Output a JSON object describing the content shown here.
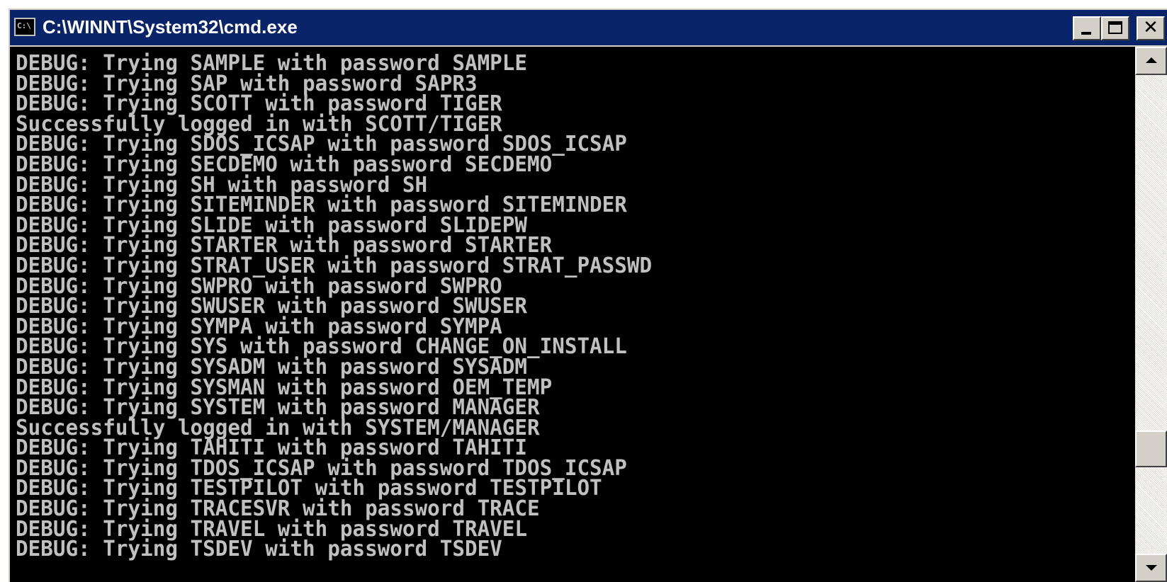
{
  "window": {
    "title": "C:\\WINNT\\System32\\cmd.exe",
    "icon": "cmd-prompt-icon",
    "icon_text": "C:\\",
    "buttons": {
      "minimize": "minimize-icon",
      "maximize": "maximize-icon",
      "close": "✕"
    }
  },
  "console": {
    "foreground": "#c0c0c0",
    "background": "#000000",
    "lines": [
      "DEBUG: Trying SAMPLE with password SAMPLE",
      "DEBUG: Trying SAP with password SAPR3",
      "DEBUG: Trying SCOTT with password TIGER",
      "Successfully logged in with SCOTT/TIGER",
      "DEBUG: Trying SDOS_ICSAP with password SDOS_ICSAP",
      "DEBUG: Trying SECDEMO with password SECDEMO",
      "DEBUG: Trying SH with password SH",
      "DEBUG: Trying SITEMINDER with password SITEMINDER",
      "DEBUG: Trying SLIDE with password SLIDEPW",
      "DEBUG: Trying STARTER with password STARTER",
      "DEBUG: Trying STRAT_USER with password STRAT_PASSWD",
      "DEBUG: Trying SWPRO with password SWPRO",
      "DEBUG: Trying SWUSER with password SWUSER",
      "DEBUG: Trying SYMPA with password SYMPA",
      "DEBUG: Trying SYS with password CHANGE_ON_INSTALL",
      "DEBUG: Trying SYSADM with password SYSADM",
      "DEBUG: Trying SYSMAN with password OEM_TEMP",
      "DEBUG: Trying SYSTEM with password MANAGER",
      "Successfully logged in with SYSTEM/MANAGER",
      "DEBUG: Trying TAHITI with password TAHITI",
      "DEBUG: Trying TDOS_ICSAP with password TDOS_ICSAP",
      "DEBUG: Trying TESTPILOT with password TESTPILOT",
      "DEBUG: Trying TRACESVR with password TRACE",
      "DEBUG: Trying TRAVEL with password TRAVEL",
      "DEBUG: Trying TSDEV with password TSDEV"
    ]
  },
  "colors": {
    "titlebar": "#0a246a",
    "chrome": "#d4d0c8"
  }
}
